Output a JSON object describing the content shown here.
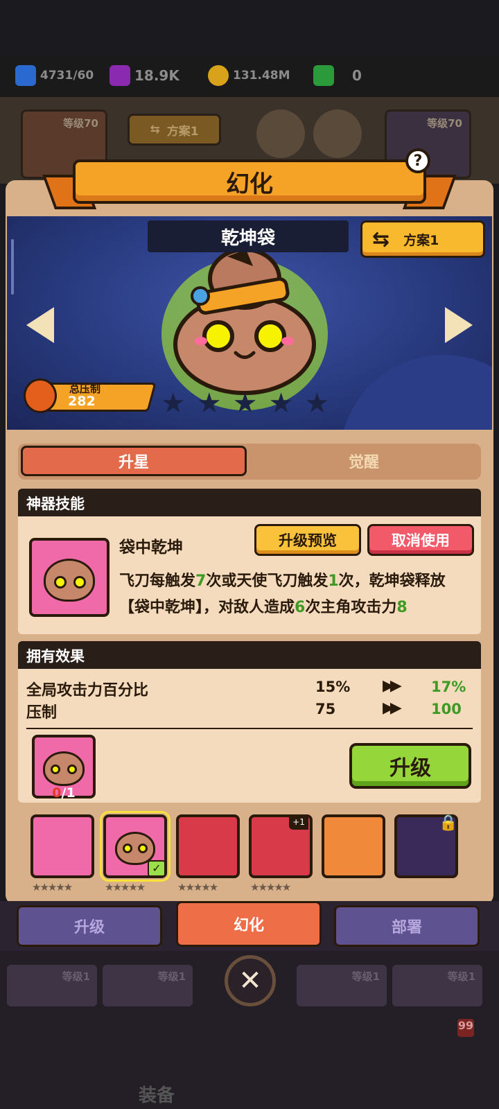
{
  "currencies": [
    {
      "icon": "energy-icon",
      "value": "4731/60"
    },
    {
      "icon": "gem-cube-icon",
      "value": "18.9K"
    },
    {
      "icon": "gold-coin-icon",
      "value": "131.48M"
    },
    {
      "icon": "green-crystal-icon",
      "value": "0"
    }
  ],
  "background": {
    "left_card_level": "等级70",
    "right_card_level": "等级70",
    "plan_button": "方案1",
    "dim_levels": [
      "等级1",
      "等级1",
      "等级1",
      "等级1",
      "等级1"
    ],
    "nav_label": "装备",
    "nav_badge": "99"
  },
  "modal": {
    "title": "幻化",
    "help": "?",
    "artifact_name": "乾坤袋",
    "plan_label": "方案1",
    "power_label": "总压制",
    "power_value": "282",
    "stars_filled": 0,
    "stars_total": 5
  },
  "tabs": {
    "active": "升星",
    "inactive": "觉醒"
  },
  "skill": {
    "section_title": "神器技能",
    "name": "袋中乾坤",
    "preview_button": "升级预览",
    "cancel_button": "取消使用",
    "desc_parts": [
      "飞刀每触发",
      "7",
      "次或天使飞刀触发",
      "1",
      "次，乾坤袋释放【袋中乾坤】，对敌人造成",
      "6",
      "次主角攻击力",
      "8"
    ]
  },
  "effects": {
    "section_title": "拥有效果",
    "rows": [
      {
        "label": "全局攻击力百分比",
        "current": "15%",
        "next": "17%"
      },
      {
        "label": "压制",
        "current": "75",
        "next": "100"
      }
    ],
    "material_have": "0",
    "material_need": "/1",
    "upgrade_button": "升级"
  },
  "artifacts": [
    {
      "name": "cannon-artifact",
      "bg": "#f06aaa",
      "stars": "★★★★★"
    },
    {
      "name": "qiankun-bag-artifact",
      "bg": "#f06aaa",
      "stars": "★★★★★",
      "selected": true
    },
    {
      "name": "lightning-spear-artifact",
      "bg": "#d83a4a",
      "stars": "★★★★★"
    },
    {
      "name": "green-blade-artifact",
      "bg": "#d83a4a",
      "stars": "★★★★★",
      "badge": "+1"
    },
    {
      "name": "golden-sword-artifact",
      "bg": "#f08a3a",
      "stars": ""
    },
    {
      "name": "locked-sword-artifact",
      "bg": "#3a2a5a",
      "stars": ""
    }
  ],
  "bottom_tabs": [
    "升级",
    "幻化",
    "部署"
  ],
  "close": "✕"
}
